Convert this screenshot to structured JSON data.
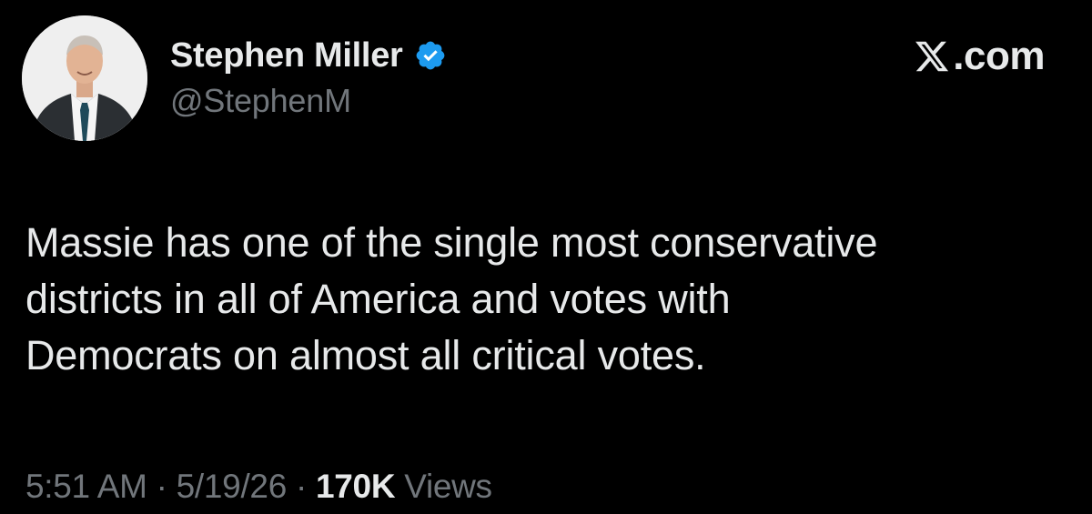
{
  "author": {
    "display_name": "Stephen Miller",
    "handle": "@StephenM",
    "verified": true
  },
  "brand": {
    "label": ".com",
    "logo_icon": "x-logo-icon"
  },
  "tweet": {
    "lines": [
      "Massie has one of the single most conservative",
      "districts in all of America and votes with",
      "Democrats on almost all critical votes."
    ]
  },
  "meta": {
    "time": "5:51 AM",
    "separator": " · ",
    "date": "5/19/26",
    "views_count": "170K",
    "views_label": " Views"
  },
  "colors": {
    "background": "#000000",
    "primary_text": "#e7e9ea",
    "secondary_text": "#71767b",
    "verified_badge": "#1d9bf0"
  },
  "icons": {
    "avatar": "avatar-photo",
    "verified": "verified-badge-icon"
  }
}
